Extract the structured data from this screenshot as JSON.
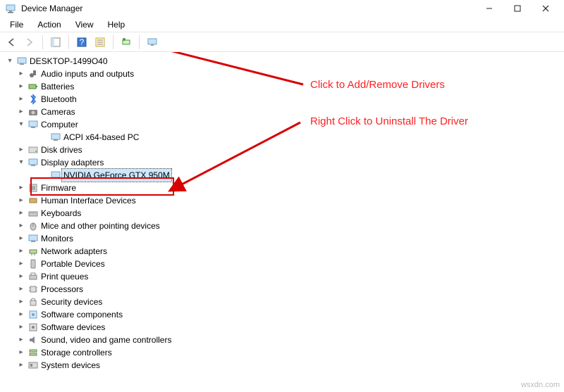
{
  "window": {
    "title": "Device Manager"
  },
  "menu": {
    "file": "File",
    "action": "Action",
    "view": "View",
    "help": "Help"
  },
  "tree": {
    "root": "DESKTOP-1499O40",
    "items": [
      {
        "label": "Audio inputs and outputs",
        "expanded": false
      },
      {
        "label": "Batteries",
        "expanded": false
      },
      {
        "label": "Bluetooth",
        "expanded": false
      },
      {
        "label": "Cameras",
        "expanded": false
      },
      {
        "label": "Computer",
        "expanded": true,
        "children": [
          {
            "label": "ACPI x64-based PC"
          }
        ]
      },
      {
        "label": "Disk drives",
        "expanded": false
      },
      {
        "label": "Display adapters",
        "expanded": true,
        "children": [
          {
            "label": "NVIDIA GeForce GTX 950M",
            "selected": true
          }
        ]
      },
      {
        "label": "Firmware",
        "expanded": false
      },
      {
        "label": "Human Interface Devices",
        "expanded": false
      },
      {
        "label": "Keyboards",
        "expanded": false
      },
      {
        "label": "Mice and other pointing devices",
        "expanded": false
      },
      {
        "label": "Monitors",
        "expanded": false
      },
      {
        "label": "Network adapters",
        "expanded": false
      },
      {
        "label": "Portable Devices",
        "expanded": false
      },
      {
        "label": "Print queues",
        "expanded": false
      },
      {
        "label": "Processors",
        "expanded": false
      },
      {
        "label": "Security devices",
        "expanded": false
      },
      {
        "label": "Software components",
        "expanded": false
      },
      {
        "label": "Software devices",
        "expanded": false
      },
      {
        "label": "Sound, video and game controllers",
        "expanded": false
      },
      {
        "label": "Storage controllers",
        "expanded": false
      },
      {
        "label": "System devices",
        "expanded": false
      }
    ]
  },
  "annotations": {
    "click_add_remove": "Click to Add/Remove Drivers",
    "right_click_uninstall": "Right Click to Uninstall The Driver"
  },
  "watermark": "wsxdn.com"
}
